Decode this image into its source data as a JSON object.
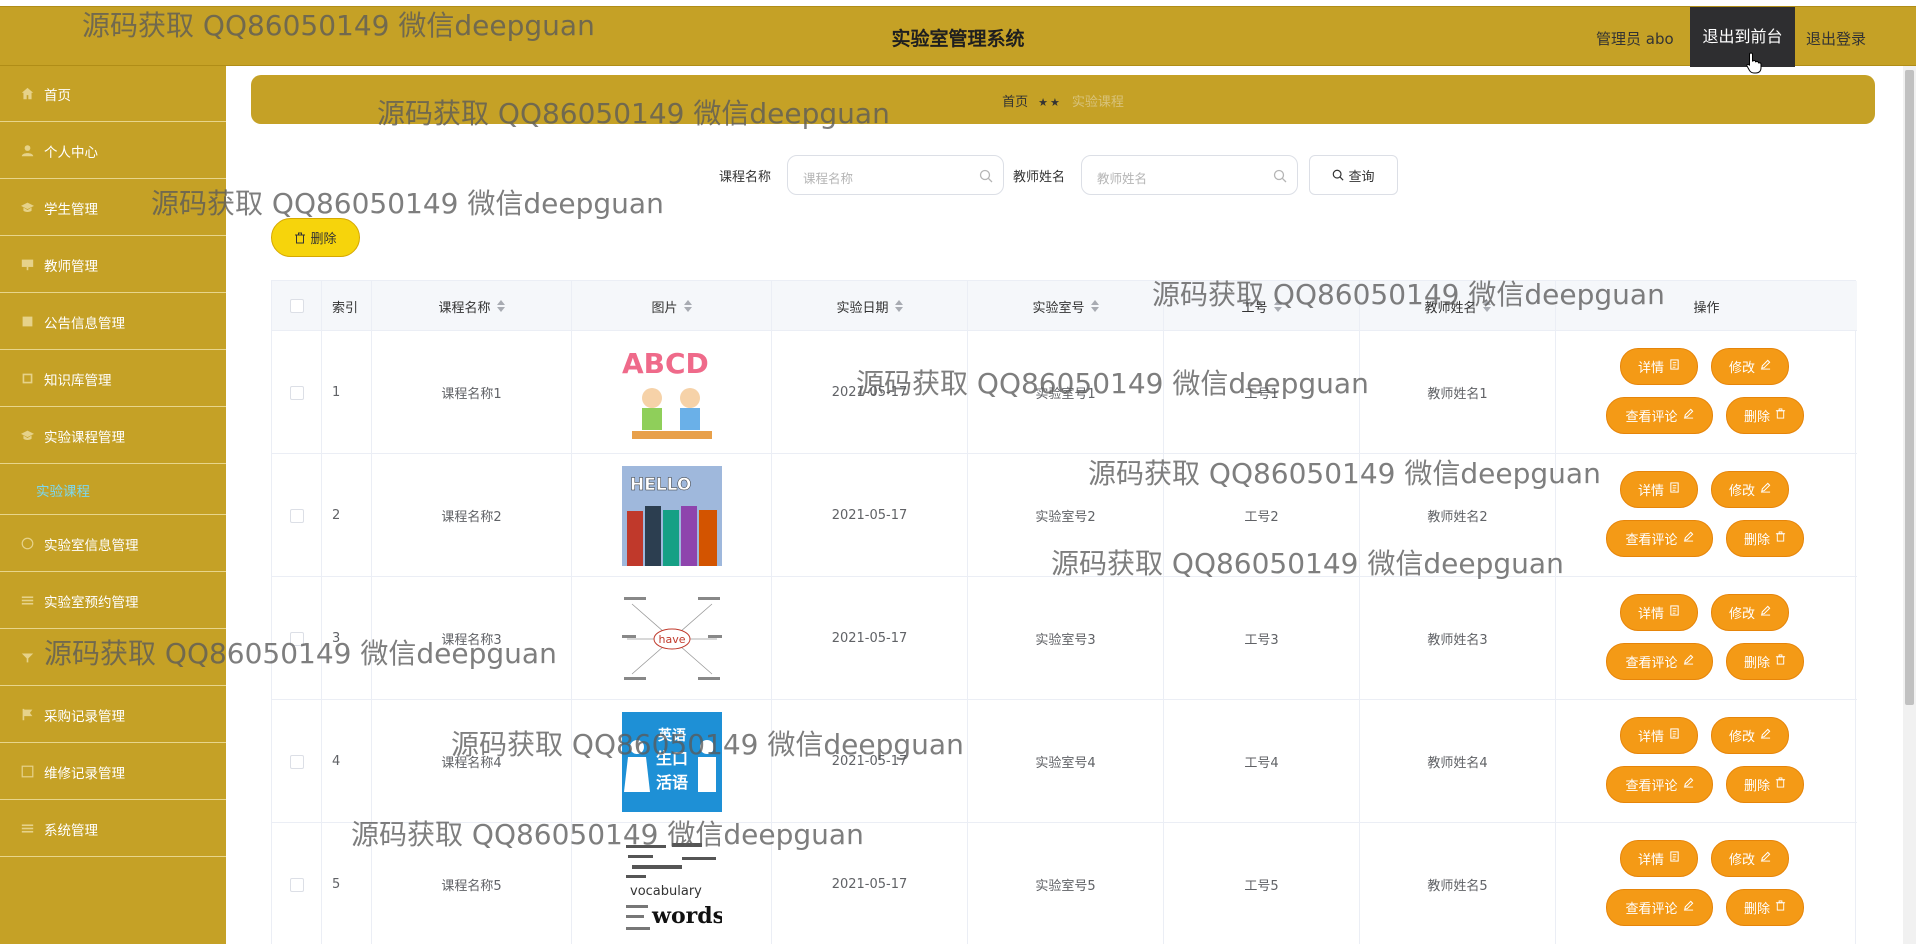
{
  "header": {
    "title": "实验室管理系统",
    "admin": "管理员 abo",
    "to_front": "退出到前台",
    "logout": "退出登录"
  },
  "sidebar": {
    "items": [
      {
        "label": "首页",
        "icon": "home-icon"
      },
      {
        "label": "个人中心",
        "icon": "user-icon"
      },
      {
        "label": "学生管理",
        "icon": "student-icon"
      },
      {
        "label": "教师管理",
        "icon": "teacher-icon"
      },
      {
        "label": "公告信息管理",
        "icon": "notice-icon"
      },
      {
        "label": "知识库管理",
        "icon": "book-icon"
      },
      {
        "label": "实验课程管理",
        "icon": "course-icon"
      },
      {
        "label": "实验课程",
        "icon": ""
      },
      {
        "label": "实验室信息管理",
        "icon": "lab-icon"
      },
      {
        "label": "实验室预约管理",
        "icon": "booking-icon"
      },
      {
        "label": "",
        "icon": "equipment-icon"
      },
      {
        "label": "采购记录管理",
        "icon": "purchase-icon"
      },
      {
        "label": "维修记录管理",
        "icon": "repair-icon"
      },
      {
        "label": "系统管理",
        "icon": "system-icon"
      }
    ]
  },
  "breadcrumb": {
    "home": "首页",
    "sep": "★★",
    "current": "实验课程"
  },
  "search": {
    "course_label": "课程名称",
    "course_placeholder": "课程名称",
    "teacher_label": "教师姓名",
    "teacher_placeholder": "教师姓名",
    "query_label": "查询"
  },
  "toolbar": {
    "delete_label": "删除"
  },
  "table": {
    "headers": [
      "索引",
      "课程名称",
      "图片",
      "实验日期",
      "实验室号",
      "工号",
      "教师姓名",
      "操作"
    ],
    "rows": [
      {
        "index": "1",
        "course": "课程名称1",
        "image": "abcd-kids-image",
        "date": "2021-05-17",
        "room": "实验室号1",
        "job_no": "工号1",
        "teacher": "教师姓名1"
      },
      {
        "index": "2",
        "course": "课程名称2",
        "image": "hello-people-image",
        "date": "2021-05-17",
        "room": "实验室号2",
        "job_no": "工号2",
        "teacher": "教师姓名2"
      },
      {
        "index": "3",
        "course": "课程名称3",
        "image": "have-mindmap-image",
        "date": "2021-05-17",
        "room": "实验室号3",
        "job_no": "工号3",
        "teacher": "教师姓名3"
      },
      {
        "index": "4",
        "course": "课程名称4",
        "image": "english-speaking-image",
        "date": "2021-05-17",
        "room": "实验室号4",
        "job_no": "工号4",
        "teacher": "教师姓名4"
      },
      {
        "index": "5",
        "course": "课程名称5",
        "image": "vocabulary-words-image",
        "date": "2021-05-17",
        "room": "实验室号5",
        "job_no": "工号5",
        "teacher": "教师姓名5"
      }
    ],
    "actions": {
      "detail": "详情",
      "edit": "修改",
      "comments": "查看评论",
      "delete": "删除"
    }
  },
  "image_text": {
    "abcd": "ABCD",
    "hello": "HELLO",
    "have": "have",
    "english_top": "英语",
    "english_mid": "生口",
    "english_bot": "活语",
    "vocab": "vocabulary",
    "words": "words"
  },
  "watermark": "源码获取 QQ86050149 微信deepguan",
  "colors": {
    "brand": "#c5a126",
    "accent_button": "#f49a16",
    "delete_button": "#f6d40c",
    "active_sub": "#7cd8f0"
  }
}
